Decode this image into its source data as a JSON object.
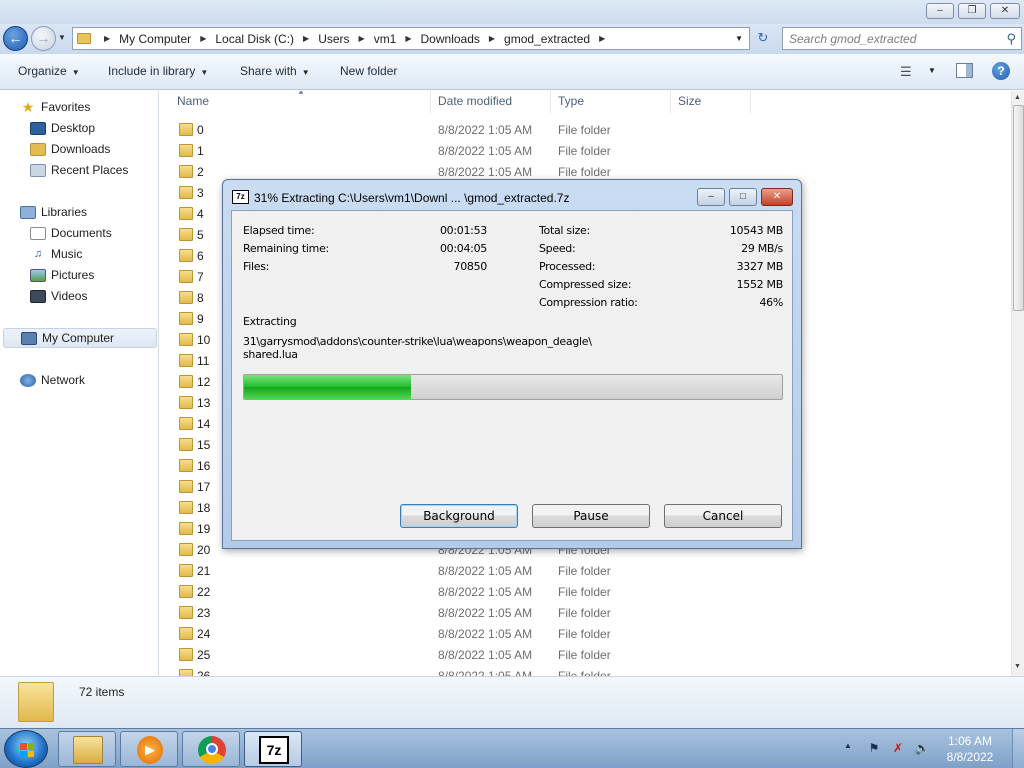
{
  "explorer": {
    "address": {
      "crumbs": [
        "My Computer",
        "Local Disk (C:)",
        "Users",
        "vm1",
        "Downloads",
        "gmod_extracted"
      ]
    },
    "search": {
      "placeholder": "Search gmod_extracted"
    },
    "toolbar": {
      "organize": "Organize",
      "include_in_library": "Include in library",
      "share_with": "Share with",
      "new_folder": "New folder"
    },
    "nav": {
      "favorites": "Favorites",
      "desktop": "Desktop",
      "downloads": "Downloads",
      "recent_places": "Recent Places",
      "libraries": "Libraries",
      "documents": "Documents",
      "music": "Music",
      "pictures": "Pictures",
      "videos": "Videos",
      "my_computer": "My Computer",
      "network": "Network"
    },
    "columns": {
      "name": "Name",
      "date_modified": "Date modified",
      "type": "Type",
      "size": "Size"
    },
    "files": [
      {
        "name": "0",
        "date": "8/8/2022 1:05 AM",
        "type": "File folder"
      },
      {
        "name": "1",
        "date": "8/8/2022 1:05 AM",
        "type": "File folder"
      },
      {
        "name": "2",
        "date": "8/8/2022 1:05 AM",
        "type": "File folder"
      },
      {
        "name": "3",
        "date": "",
        "type": ""
      },
      {
        "name": "4",
        "date": "",
        "type": ""
      },
      {
        "name": "5",
        "date": "",
        "type": ""
      },
      {
        "name": "6",
        "date": "",
        "type": ""
      },
      {
        "name": "7",
        "date": "",
        "type": ""
      },
      {
        "name": "8",
        "date": "",
        "type": ""
      },
      {
        "name": "9",
        "date": "",
        "type": ""
      },
      {
        "name": "10",
        "date": "",
        "type": ""
      },
      {
        "name": "11",
        "date": "",
        "type": ""
      },
      {
        "name": "12",
        "date": "",
        "type": ""
      },
      {
        "name": "13",
        "date": "",
        "type": ""
      },
      {
        "name": "14",
        "date": "",
        "type": ""
      },
      {
        "name": "15",
        "date": "",
        "type": ""
      },
      {
        "name": "16",
        "date": "",
        "type": ""
      },
      {
        "name": "17",
        "date": "",
        "type": ""
      },
      {
        "name": "18",
        "date": "",
        "type": ""
      },
      {
        "name": "19",
        "date": "",
        "type": ""
      },
      {
        "name": "20",
        "date": "8/8/2022 1:05 AM",
        "type": "File folder"
      },
      {
        "name": "21",
        "date": "8/8/2022 1:05 AM",
        "type": "File folder"
      },
      {
        "name": "22",
        "date": "8/8/2022 1:05 AM",
        "type": "File folder"
      },
      {
        "name": "23",
        "date": "8/8/2022 1:05 AM",
        "type": "File folder"
      },
      {
        "name": "24",
        "date": "8/8/2022 1:05 AM",
        "type": "File folder"
      },
      {
        "name": "25",
        "date": "8/8/2022 1:05 AM",
        "type": "File folder"
      },
      {
        "name": "26",
        "date": "8/8/2022 1:05 AM",
        "type": "File folder"
      }
    ],
    "details": {
      "item_count": "72 items"
    }
  },
  "dialog": {
    "title": "31% Extracting C:\\Users\\vm1\\Downl ... \\gmod_extracted.7z",
    "icon_text": "7z",
    "stats_left": [
      {
        "label": "Elapsed time:",
        "value": "00:01:53"
      },
      {
        "label": "Remaining time:",
        "value": "00:04:05"
      },
      {
        "label": "Files:",
        "value": "70850"
      }
    ],
    "stats_right": [
      {
        "label": "Total size:",
        "value": "10543 MB"
      },
      {
        "label": "Speed:",
        "value": "29 MB/s"
      },
      {
        "label": "Processed:",
        "value": "3327 MB"
      },
      {
        "label": "Compressed size:",
        "value": "1552 MB"
      },
      {
        "label": "Compression ratio:",
        "value": "46%"
      }
    ],
    "status_label": "Extracting",
    "current_file_line1": "31\\garrysmod\\addons\\counter-strike\\lua\\weapons\\weapon_deagle\\",
    "current_file_line2": "shared.lua",
    "progress_fraction": 0.31,
    "progress_color": "#1fbd2a",
    "buttons": {
      "background": "Background",
      "pause": "Pause",
      "cancel": "Cancel"
    }
  },
  "taskbar": {
    "apps": [
      "explorer",
      "media-player",
      "chrome",
      "7zip"
    ],
    "sevenzip_label": "7z",
    "clock_time": "1:06 AM",
    "clock_date": "8/8/2022"
  }
}
